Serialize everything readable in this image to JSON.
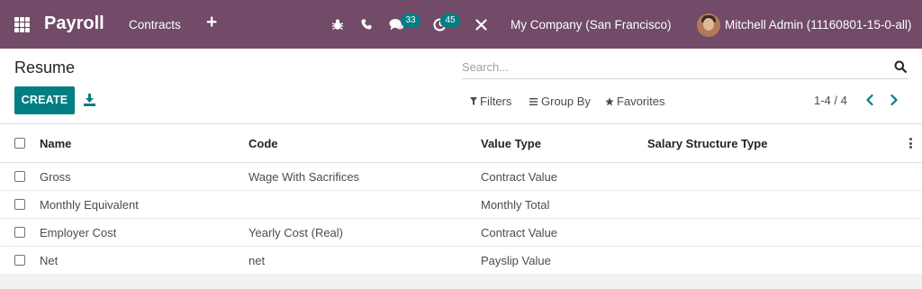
{
  "navbar": {
    "app_name": "Payroll",
    "menu_contracts": "Contracts",
    "menu_new": "+",
    "messages_count": "33",
    "activities_count": "45",
    "company": "My Company (San Francisco)",
    "user": "Mitchell Admin (11160801-15-0-all)",
    "icons": [
      "bug-icon",
      "phone-icon",
      "chat-icon",
      "clock-icon",
      "tools-icon"
    ]
  },
  "control_panel": {
    "breadcrumb": "Resume",
    "search_placeholder": "Search...",
    "create_label": "CREATE",
    "filters_label": "Filters",
    "groupby_label": "Group By",
    "favorites_label": "Favorites",
    "pager": "1-4 / 4"
  },
  "list": {
    "columns": [
      "Name",
      "Code",
      "Value Type",
      "Salary Structure Type"
    ],
    "rows": [
      {
        "name": "Gross",
        "code": "Wage With Sacrifices",
        "value_type": "Contract Value",
        "structure_type": ""
      },
      {
        "name": "Monthly Equivalent",
        "code": "",
        "value_type": "Monthly Total",
        "structure_type": ""
      },
      {
        "name": "Employer Cost",
        "code": "Yearly Cost (Real)",
        "value_type": "Contract Value",
        "structure_type": ""
      },
      {
        "name": "Net",
        "code": "net",
        "value_type": "Payslip Value",
        "structure_type": ""
      }
    ]
  },
  "colors": {
    "navbar": "#714b67",
    "primary": "#017e84",
    "text": "#4c4c4c"
  }
}
